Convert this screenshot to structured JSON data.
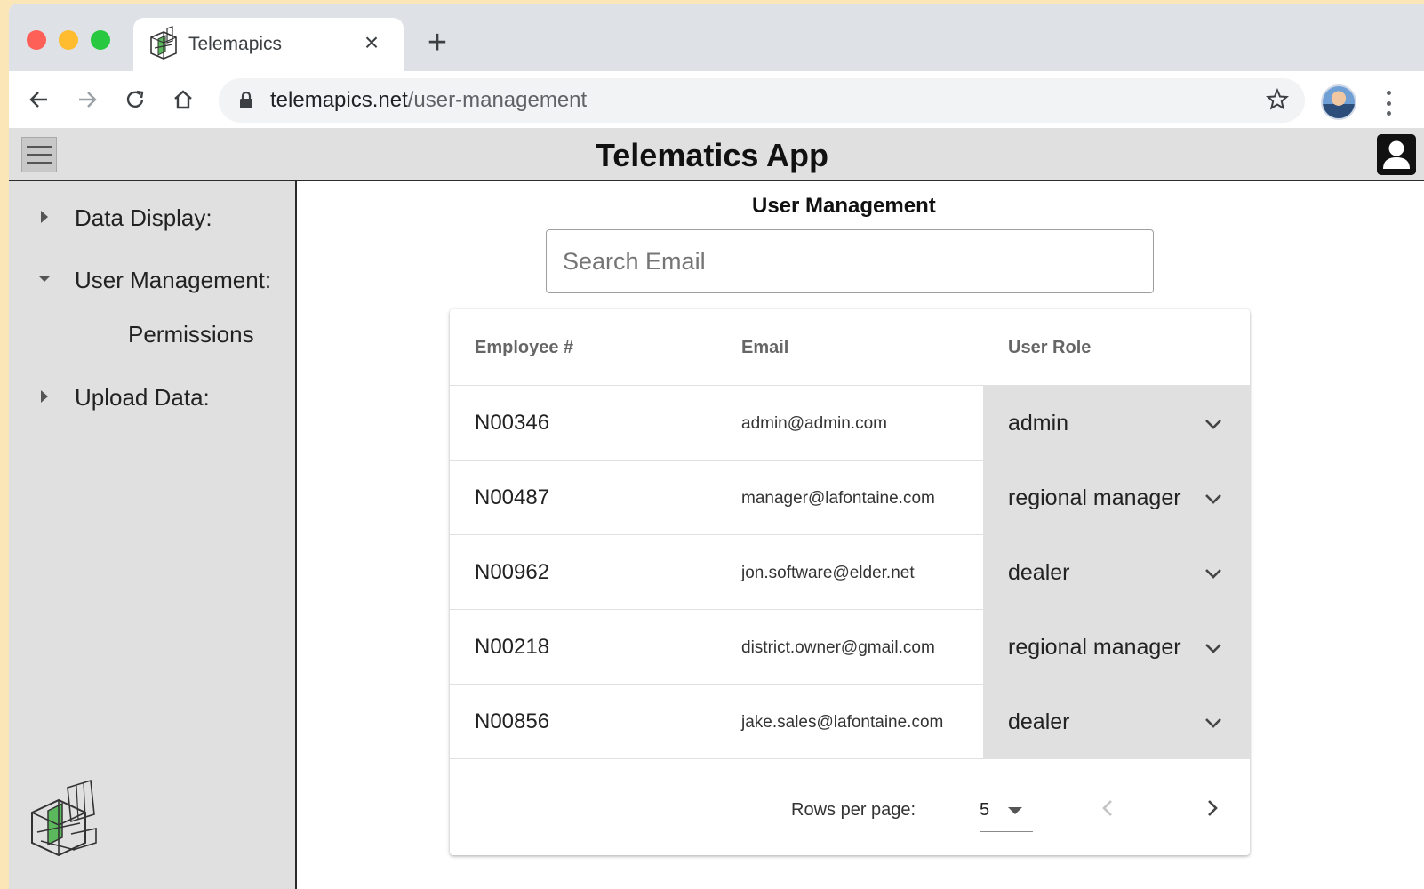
{
  "browser": {
    "tab_title": "Telemapics",
    "url_host": "telemapics.net",
    "url_path": "/user-management"
  },
  "app": {
    "title": "Telematics App"
  },
  "sidebar": {
    "items": [
      {
        "label": "Data Display:",
        "expanded": false
      },
      {
        "label": "User Management:",
        "expanded": true
      },
      {
        "label": "Upload Data:",
        "expanded": false
      }
    ],
    "subitems": [
      {
        "label": "Permissions"
      }
    ]
  },
  "main": {
    "heading": "User Management",
    "search_placeholder": "Search Email",
    "search_value": ""
  },
  "table": {
    "headers": [
      "Employee #",
      "Email",
      "User Role"
    ],
    "rows": [
      {
        "employee": "N00346",
        "email": "admin@admin.com",
        "role": "admin"
      },
      {
        "employee": "N00487",
        "email": "manager@lafontaine.com",
        "role": "regional manager"
      },
      {
        "employee": "N00962",
        "email": "jon.software@elder.net",
        "role": "dealer"
      },
      {
        "employee": "N00218",
        "email": "district.owner@gmail.com",
        "role": "regional manager"
      },
      {
        "employee": "N00856",
        "email": "jake.sales@lafontaine.com",
        "role": "dealer"
      }
    ]
  },
  "pagination": {
    "rows_per_page_label": "Rows per page:",
    "rows_per_page": "5"
  },
  "colors": {
    "app_chrome": "#e0e0e0",
    "role_cell": "#e0e0e0",
    "tab_strip": "#dee1e6"
  }
}
